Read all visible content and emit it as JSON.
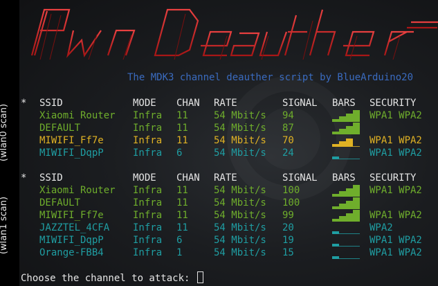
{
  "banner": {
    "logo_text": "PwnDeauther",
    "colors": {
      "primary": "#cc1f1f",
      "highlight": "#e84040"
    }
  },
  "subtitle": "The MDK3 channel deauther script by BlueArduino20",
  "side_labels": {
    "scan1": "(wlan0 scan)",
    "scan2": "(wlan1 scan)"
  },
  "headers": {
    "star": "*",
    "ssid": "SSID",
    "mode": "MODE",
    "chan": "CHAN",
    "rate": "RATE",
    "signal": "SIGNAL",
    "bars": "BARS",
    "security": "SECURITY"
  },
  "colors": {
    "green": "#6fae2c",
    "yellow": "#e0b224",
    "cyan": "#1f9ea3",
    "header": "#e6e6e6",
    "subtitle": "#3a6bbf"
  },
  "scan1": [
    {
      "ssid": "Xiaomi Router",
      "mode": "Infra",
      "chan": "11",
      "rate": "54 Mbit/s",
      "signal": "94",
      "security": "WPA1 WPA2",
      "color": "green",
      "bars": 4
    },
    {
      "ssid": "DEFAULT",
      "mode": "Infra",
      "chan": "11",
      "rate": "54 Mbit/s",
      "signal": "87",
      "security": "",
      "color": "green",
      "bars": 4
    },
    {
      "ssid": "MIWIFI_Ff7e",
      "mode": "Infra",
      "chan": "11",
      "rate": "54 Mbit/s",
      "signal": "70",
      "security": "WPA1 WPA2",
      "color": "yellow",
      "bars": 3
    },
    {
      "ssid": "MIWIFI_DqpP",
      "mode": "Infra",
      "chan": "6",
      "rate": "54 Mbit/s",
      "signal": "24",
      "security": "WPA1 WPA2",
      "color": "cyan",
      "bars": 1
    }
  ],
  "scan2": [
    {
      "ssid": "Xiaomi Router",
      "mode": "Infra",
      "chan": "11",
      "rate": "54 Mbit/s",
      "signal": "100",
      "security": "WPA1 WPA2",
      "color": "green",
      "bars": 4
    },
    {
      "ssid": "DEFAULT",
      "mode": "Infra",
      "chan": "11",
      "rate": "54 Mbit/s",
      "signal": "100",
      "security": "",
      "color": "green",
      "bars": 4
    },
    {
      "ssid": "MIWIFI_Ff7e",
      "mode": "Infra",
      "chan": "11",
      "rate": "54 Mbit/s",
      "signal": "99",
      "security": "WPA1 WPA2",
      "color": "green",
      "bars": 4
    },
    {
      "ssid": "JAZZTEL_4CFA",
      "mode": "Infra",
      "chan": "11",
      "rate": "54 Mbit/s",
      "signal": "20",
      "security": "WPA2",
      "color": "cyan",
      "bars": 1
    },
    {
      "ssid": "MIWIFI_DqpP",
      "mode": "Infra",
      "chan": "6",
      "rate": "54 Mbit/s",
      "signal": "19",
      "security": "WPA1 WPA2",
      "color": "cyan",
      "bars": 1
    },
    {
      "ssid": "Orange-FBB4",
      "mode": "Infra",
      "chan": "1",
      "rate": "54 Mbit/s",
      "signal": "15",
      "security": "WPA1 WPA2",
      "color": "cyan",
      "bars": 1
    }
  ],
  "prompt": {
    "text": "Choose the channel to attack:",
    "input_value": ""
  }
}
